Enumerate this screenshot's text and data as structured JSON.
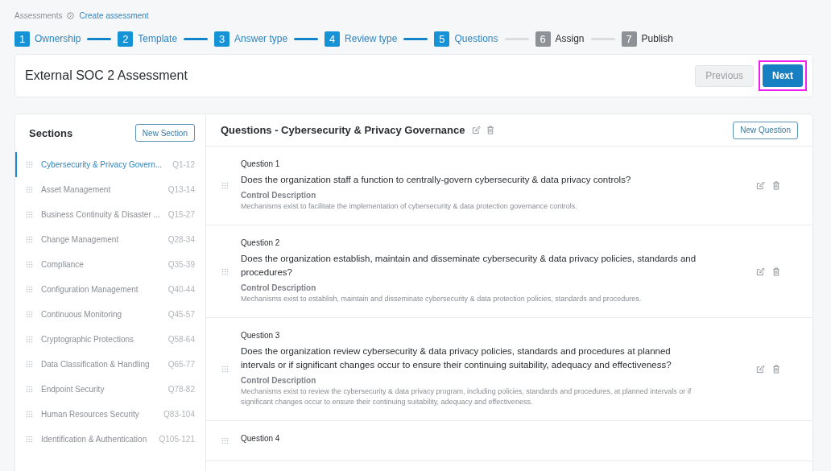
{
  "breadcrumb": {
    "parent": "Assessments",
    "current": "Create assessment"
  },
  "steps": [
    {
      "number": "1",
      "label": "Ownership",
      "active": true
    },
    {
      "number": "2",
      "label": "Template",
      "active": true
    },
    {
      "number": "3",
      "label": "Answer type",
      "active": true
    },
    {
      "number": "4",
      "label": "Review type",
      "active": true
    },
    {
      "number": "5",
      "label": "Questions",
      "active": true
    },
    {
      "number": "6",
      "label": "Assign",
      "active": false
    },
    {
      "number": "7",
      "label": "Publish",
      "active": false
    }
  ],
  "header": {
    "title": "External SOC 2 Assessment",
    "previous_button": {
      "label": "Previous",
      "disabled": true
    },
    "next_button": {
      "label": "Next",
      "highlighted": true
    }
  },
  "sections": {
    "title": "Sections",
    "new_button": "New Section",
    "items": [
      {
        "name": "Cybersecurity & Privacy Govern...",
        "range": "Q1-12",
        "selected": true
      },
      {
        "name": "Asset Management",
        "range": "Q13-14",
        "selected": false
      },
      {
        "name": "Business Continuity & Disaster ...",
        "range": "Q15-27",
        "selected": false
      },
      {
        "name": "Change Management",
        "range": "Q28-34",
        "selected": false
      },
      {
        "name": "Compliance",
        "range": "Q35-39",
        "selected": false
      },
      {
        "name": "Configuration Management",
        "range": "Q40-44",
        "selected": false
      },
      {
        "name": "Continuous Monitoring",
        "range": "Q45-57",
        "selected": false
      },
      {
        "name": "Cryptographic Protections",
        "range": "Q58-64",
        "selected": false
      },
      {
        "name": "Data Classification & Handling",
        "range": "Q65-77",
        "selected": false
      },
      {
        "name": "Endpoint Security",
        "range": "Q78-82",
        "selected": false
      },
      {
        "name": "Human Resources Security",
        "range": "Q83-104",
        "selected": false
      },
      {
        "name": "Identification & Authentication",
        "range": "Q105-121",
        "selected": false
      }
    ]
  },
  "questions": {
    "title": "Questions - Cybersecurity & Privacy Governance",
    "new_button": "New Question",
    "items": [
      {
        "label": "Question 1",
        "text": "Does the organization staff a function to centrally-govern cybersecurity & data privacy controls?",
        "description_label": "Control Description",
        "description": "Mechanisms exist to facilitate the implementation of cybersecurity & data protection governance controls."
      },
      {
        "label": "Question 2",
        "text": "Does the organization establish, maintain and disseminate cybersecurity & data privacy policies, standards and procedures?",
        "description_label": "Control Description",
        "description": "Mechanisms exist to establish, maintain and disseminate cybersecurity & data protection policies, standards and procedures."
      },
      {
        "label": "Question 3",
        "text": "Does the organization review cybersecurity & data privacy policies, standards and procedures at planned intervals or if significant changes occur to ensure their continuing suitability, adequacy and effectiveness?",
        "description_label": "Control Description",
        "description": "Mechanisms exist to review the cybersecurity & data privacy program, including policies, standards and procedures, at planned intervals or if significant changes occur to ensure their continuing suitability, adequacy and effectiveness."
      },
      {
        "label": "Question 4"
      }
    ]
  }
}
